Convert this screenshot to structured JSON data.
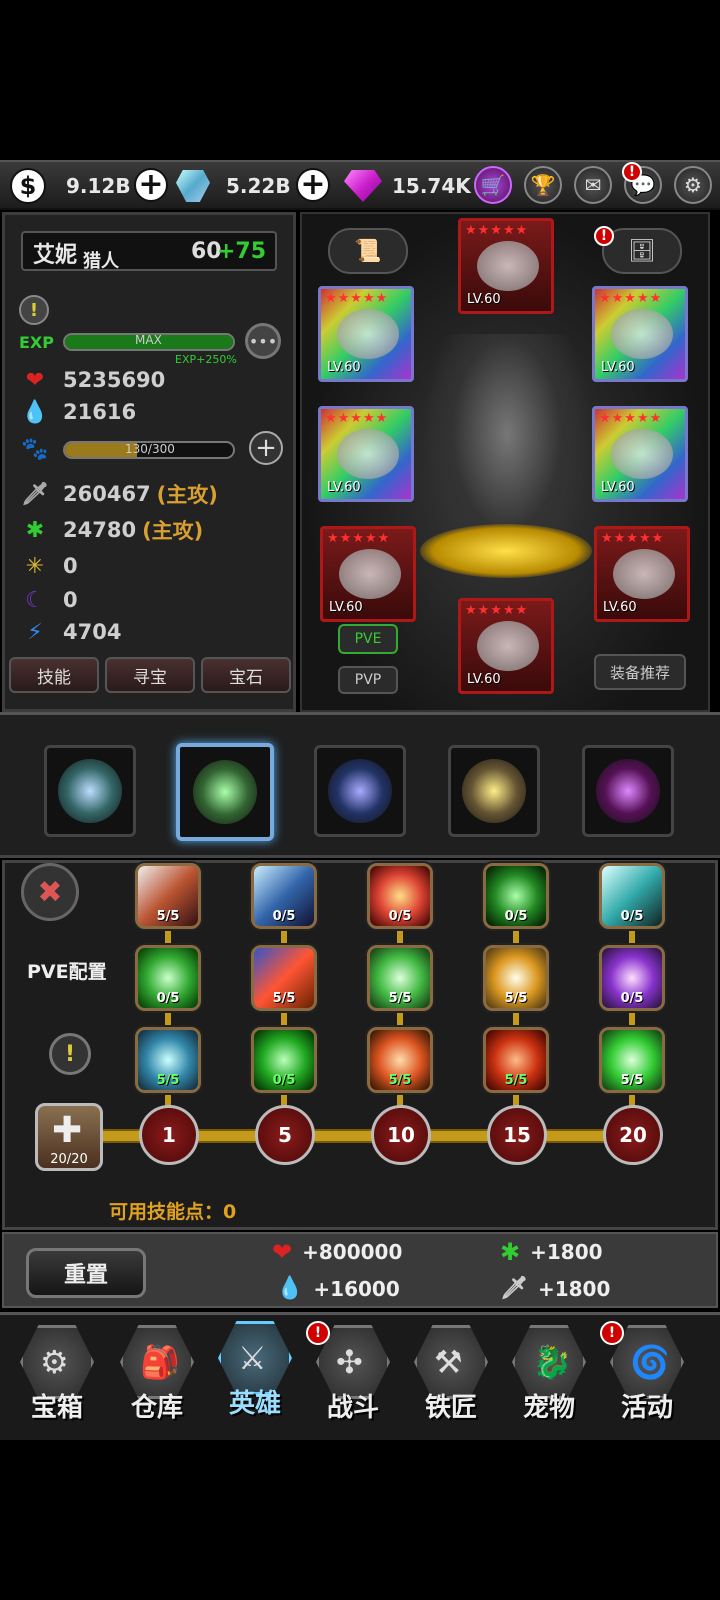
{
  "currency": {
    "gold": "9.12B",
    "crystal": "5.22B",
    "gem": "15.74K"
  },
  "hero": {
    "name": "艾妮",
    "class": "猎人",
    "level": "60",
    "level_bonus": "+75"
  },
  "exp": {
    "label": "EXP",
    "bar_text": "MAX",
    "bonus": "EXP+250%"
  },
  "stats": {
    "hp": "5235690",
    "mp": "21616",
    "pet_bar": "130/300",
    "attack": "260467",
    "attack_tag": "(主攻)",
    "secondary": "24780",
    "secondary_tag": "(主攻)",
    "stat3": "0",
    "stat4": "0",
    "stat5": "4704"
  },
  "left_tabs": [
    "技能",
    "寻宝",
    "宝石"
  ],
  "equipment": {
    "lv": [
      "LV.60",
      "LV.60",
      "LV.60",
      "LV.60",
      "LV.60",
      "LV.60",
      "LV.60",
      "LV.60"
    ],
    "pve": "PVE",
    "pvp": "PVP",
    "recommend": "装备推荐"
  },
  "skills": {
    "config_label": "PVE配置",
    "row1": [
      "5/5",
      "0/5",
      "0/5",
      "0/5",
      "0/5"
    ],
    "row2": [
      "0/5",
      "5/5",
      "5/5",
      "5/5",
      "0/5"
    ],
    "row3": [
      "5/5",
      "0/5",
      "5/5",
      "5/5",
      "5/5"
    ],
    "nodes": [
      "1",
      "5",
      "10",
      "15",
      "20"
    ],
    "points_box": "20/20",
    "available": "可用技能点：0"
  },
  "reset_label": "重置",
  "bonuses": {
    "hp": "+800000",
    "mp": "+16000",
    "secondary": "+1800",
    "attack": "+1800"
  },
  "nav": [
    "宝箱",
    "仓库",
    "英雄",
    "战斗",
    "铁匠",
    "宠物",
    "活动"
  ]
}
